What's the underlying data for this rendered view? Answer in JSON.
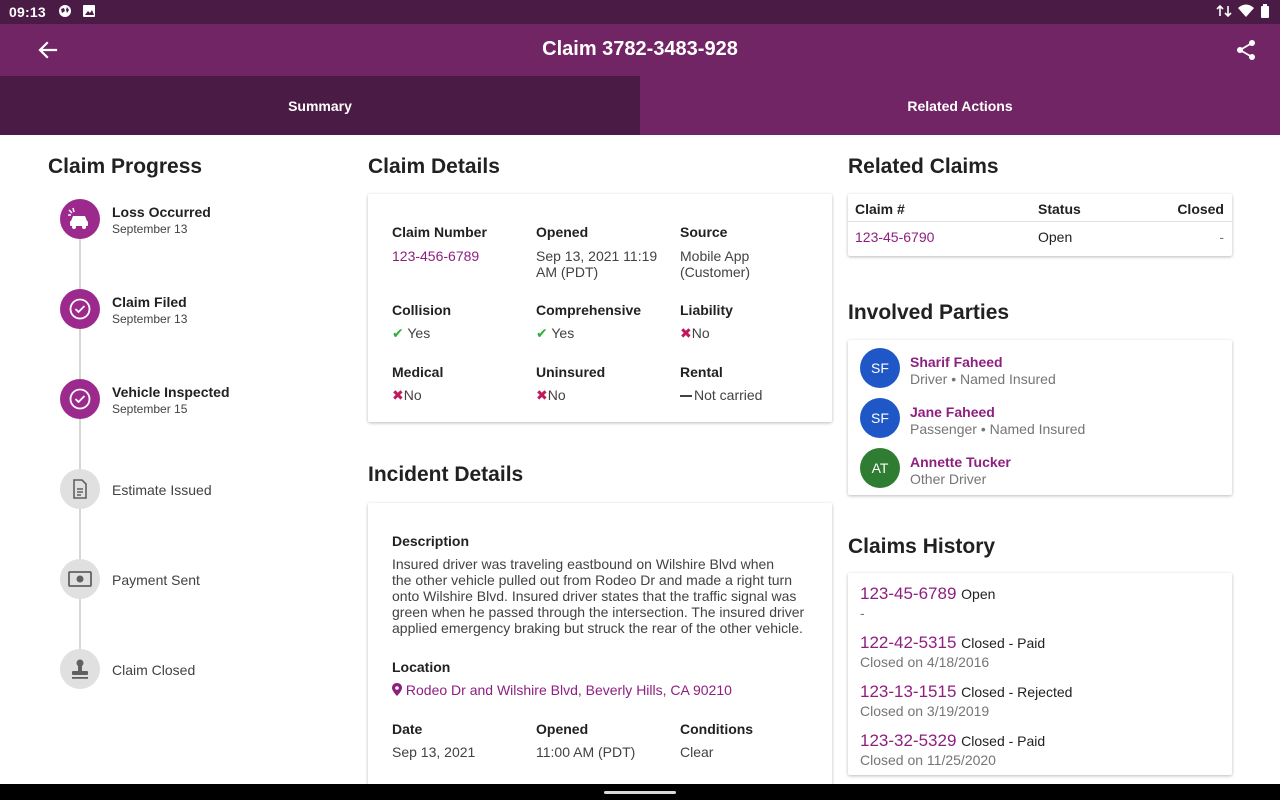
{
  "statusbar": {
    "time": "09:13"
  },
  "appbar": {
    "title": "Claim 3782-3483-928"
  },
  "tabs": [
    {
      "label": "Summary",
      "active": true
    },
    {
      "label": "Related Actions",
      "active": false
    }
  ],
  "progress": {
    "heading": "Claim Progress",
    "steps": [
      {
        "title": "Loss Occurred",
        "date": "September 13",
        "done": true,
        "icon": "car-crash-icon"
      },
      {
        "title": "Claim Filed",
        "date": "September 13",
        "done": true,
        "icon": "check-circle-icon"
      },
      {
        "title": "Vehicle Inspected",
        "date": "September 15",
        "done": true,
        "icon": "check-circle-icon"
      },
      {
        "title": "Estimate Issued",
        "date": "",
        "done": false,
        "icon": "document-icon"
      },
      {
        "title": "Payment Sent",
        "date": "",
        "done": false,
        "icon": "money-icon"
      },
      {
        "title": "Claim Closed",
        "date": "",
        "done": false,
        "icon": "stamp-icon"
      }
    ]
  },
  "claim_details": {
    "heading": "Claim Details",
    "claim_number_label": "Claim Number",
    "claim_number": "123-456-6789",
    "opened_label": "Opened",
    "opened_line1": "Sep 13, 2021 11:19",
    "opened_line2": "AM (PDT)",
    "source_label": "Source",
    "source_line1": "Mobile App",
    "source_line2": "(Customer)",
    "collision_label": "Collision",
    "collision": "Yes",
    "comprehensive_label": "Comprehensive",
    "comprehensive": "Yes",
    "liability_label": "Liability",
    "liability": "No",
    "medical_label": "Medical",
    "medical": "No",
    "uninsured_label": "Uninsured",
    "uninsured": "No",
    "rental_label": "Rental",
    "rental": "Not carried"
  },
  "incident": {
    "heading": "Incident Details",
    "description_label": "Description",
    "description_lines": [
      "Insured driver was traveling eastbound on Wilshire Blvd when",
      "the other vehicle pulled out from Rodeo Dr and made a right turn",
      "onto Wilshire Blvd. Insured driver states that the traffic signal was",
      "green when he passed through the intersection. The insured driver",
      "applied emergency braking but struck the rear of the other vehicle."
    ],
    "location_label": "Location",
    "location": "Rodeo Dr and Wilshire Blvd, Beverly Hills, CA 90210",
    "date_label": "Date",
    "date": "Sep 13, 2021",
    "opened_label": "Opened",
    "opened": "11:00 AM (PDT)",
    "conditions_label": "Conditions",
    "conditions": "Clear"
  },
  "related_claims": {
    "heading": "Related Claims",
    "columns": [
      "Claim #",
      "Status",
      "Closed"
    ],
    "rows": [
      {
        "claim": "123-45-6790",
        "status": "Open",
        "closed": "-"
      }
    ]
  },
  "parties": {
    "heading": "Involved Parties",
    "items": [
      {
        "initials": "SF",
        "name": "Sharif Faheed",
        "role": "Driver • Named Insured",
        "color": "#1f58c6"
      },
      {
        "initials": "SF",
        "name": "Jane Faheed",
        "role": "Passenger • Named Insured",
        "color": "#1f58c6"
      },
      {
        "initials": "AT",
        "name": "Annette Tucker",
        "role": "Other Driver",
        "color": "#2e7d32"
      }
    ]
  },
  "history": {
    "heading": "Claims History",
    "items": [
      {
        "number": "123-45-6789",
        "status": "Open",
        "sub": "-"
      },
      {
        "number": "122-42-5315",
        "status": "Closed - Paid",
        "sub": "Closed on 4/18/2016"
      },
      {
        "number": "123-13-1515",
        "status": "Closed - Rejected",
        "sub": "Closed on 3/19/2019"
      },
      {
        "number": "123-32-5329",
        "status": "Closed - Paid",
        "sub": "Closed on 11/25/2020"
      }
    ]
  },
  "colors": {
    "appbar": "#722565",
    "statusbar": "#4a1b45",
    "accent": "#9b2a8c",
    "link": "#8e1f7f",
    "yes": "#2eae3b",
    "no": "#c2185b"
  }
}
